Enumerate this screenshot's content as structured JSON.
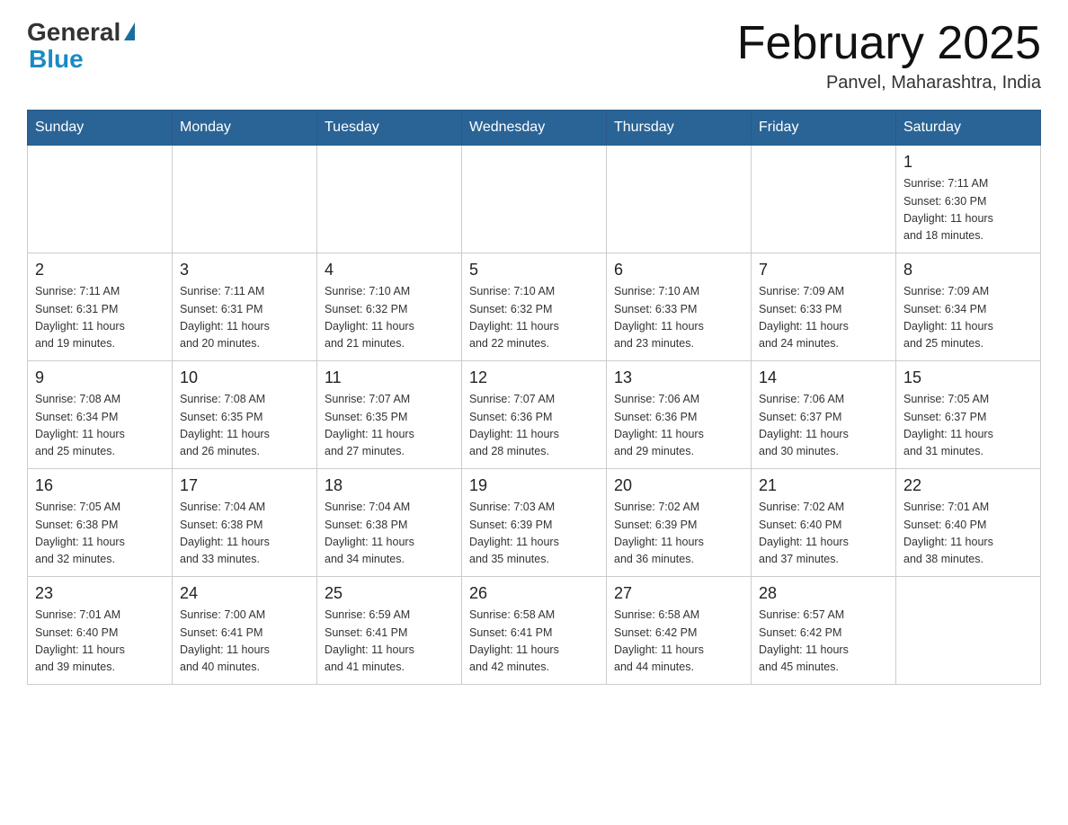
{
  "header": {
    "logo_general": "General",
    "logo_blue": "Blue",
    "title": "February 2025",
    "subtitle": "Panvel, Maharashtra, India"
  },
  "calendar": {
    "days_of_week": [
      "Sunday",
      "Monday",
      "Tuesday",
      "Wednesday",
      "Thursday",
      "Friday",
      "Saturday"
    ],
    "weeks": [
      [
        {
          "day": "",
          "info": ""
        },
        {
          "day": "",
          "info": ""
        },
        {
          "day": "",
          "info": ""
        },
        {
          "day": "",
          "info": ""
        },
        {
          "day": "",
          "info": ""
        },
        {
          "day": "",
          "info": ""
        },
        {
          "day": "1",
          "info": "Sunrise: 7:11 AM\nSunset: 6:30 PM\nDaylight: 11 hours\nand 18 minutes."
        }
      ],
      [
        {
          "day": "2",
          "info": "Sunrise: 7:11 AM\nSunset: 6:31 PM\nDaylight: 11 hours\nand 19 minutes."
        },
        {
          "day": "3",
          "info": "Sunrise: 7:11 AM\nSunset: 6:31 PM\nDaylight: 11 hours\nand 20 minutes."
        },
        {
          "day": "4",
          "info": "Sunrise: 7:10 AM\nSunset: 6:32 PM\nDaylight: 11 hours\nand 21 minutes."
        },
        {
          "day": "5",
          "info": "Sunrise: 7:10 AM\nSunset: 6:32 PM\nDaylight: 11 hours\nand 22 minutes."
        },
        {
          "day": "6",
          "info": "Sunrise: 7:10 AM\nSunset: 6:33 PM\nDaylight: 11 hours\nand 23 minutes."
        },
        {
          "day": "7",
          "info": "Sunrise: 7:09 AM\nSunset: 6:33 PM\nDaylight: 11 hours\nand 24 minutes."
        },
        {
          "day": "8",
          "info": "Sunrise: 7:09 AM\nSunset: 6:34 PM\nDaylight: 11 hours\nand 25 minutes."
        }
      ],
      [
        {
          "day": "9",
          "info": "Sunrise: 7:08 AM\nSunset: 6:34 PM\nDaylight: 11 hours\nand 25 minutes."
        },
        {
          "day": "10",
          "info": "Sunrise: 7:08 AM\nSunset: 6:35 PM\nDaylight: 11 hours\nand 26 minutes."
        },
        {
          "day": "11",
          "info": "Sunrise: 7:07 AM\nSunset: 6:35 PM\nDaylight: 11 hours\nand 27 minutes."
        },
        {
          "day": "12",
          "info": "Sunrise: 7:07 AM\nSunset: 6:36 PM\nDaylight: 11 hours\nand 28 minutes."
        },
        {
          "day": "13",
          "info": "Sunrise: 7:06 AM\nSunset: 6:36 PM\nDaylight: 11 hours\nand 29 minutes."
        },
        {
          "day": "14",
          "info": "Sunrise: 7:06 AM\nSunset: 6:37 PM\nDaylight: 11 hours\nand 30 minutes."
        },
        {
          "day": "15",
          "info": "Sunrise: 7:05 AM\nSunset: 6:37 PM\nDaylight: 11 hours\nand 31 minutes."
        }
      ],
      [
        {
          "day": "16",
          "info": "Sunrise: 7:05 AM\nSunset: 6:38 PM\nDaylight: 11 hours\nand 32 minutes."
        },
        {
          "day": "17",
          "info": "Sunrise: 7:04 AM\nSunset: 6:38 PM\nDaylight: 11 hours\nand 33 minutes."
        },
        {
          "day": "18",
          "info": "Sunrise: 7:04 AM\nSunset: 6:38 PM\nDaylight: 11 hours\nand 34 minutes."
        },
        {
          "day": "19",
          "info": "Sunrise: 7:03 AM\nSunset: 6:39 PM\nDaylight: 11 hours\nand 35 minutes."
        },
        {
          "day": "20",
          "info": "Sunrise: 7:02 AM\nSunset: 6:39 PM\nDaylight: 11 hours\nand 36 minutes."
        },
        {
          "day": "21",
          "info": "Sunrise: 7:02 AM\nSunset: 6:40 PM\nDaylight: 11 hours\nand 37 minutes."
        },
        {
          "day": "22",
          "info": "Sunrise: 7:01 AM\nSunset: 6:40 PM\nDaylight: 11 hours\nand 38 minutes."
        }
      ],
      [
        {
          "day": "23",
          "info": "Sunrise: 7:01 AM\nSunset: 6:40 PM\nDaylight: 11 hours\nand 39 minutes."
        },
        {
          "day": "24",
          "info": "Sunrise: 7:00 AM\nSunset: 6:41 PM\nDaylight: 11 hours\nand 40 minutes."
        },
        {
          "day": "25",
          "info": "Sunrise: 6:59 AM\nSunset: 6:41 PM\nDaylight: 11 hours\nand 41 minutes."
        },
        {
          "day": "26",
          "info": "Sunrise: 6:58 AM\nSunset: 6:41 PM\nDaylight: 11 hours\nand 42 minutes."
        },
        {
          "day": "27",
          "info": "Sunrise: 6:58 AM\nSunset: 6:42 PM\nDaylight: 11 hours\nand 44 minutes."
        },
        {
          "day": "28",
          "info": "Sunrise: 6:57 AM\nSunset: 6:42 PM\nDaylight: 11 hours\nand 45 minutes."
        },
        {
          "day": "",
          "info": ""
        }
      ]
    ]
  }
}
